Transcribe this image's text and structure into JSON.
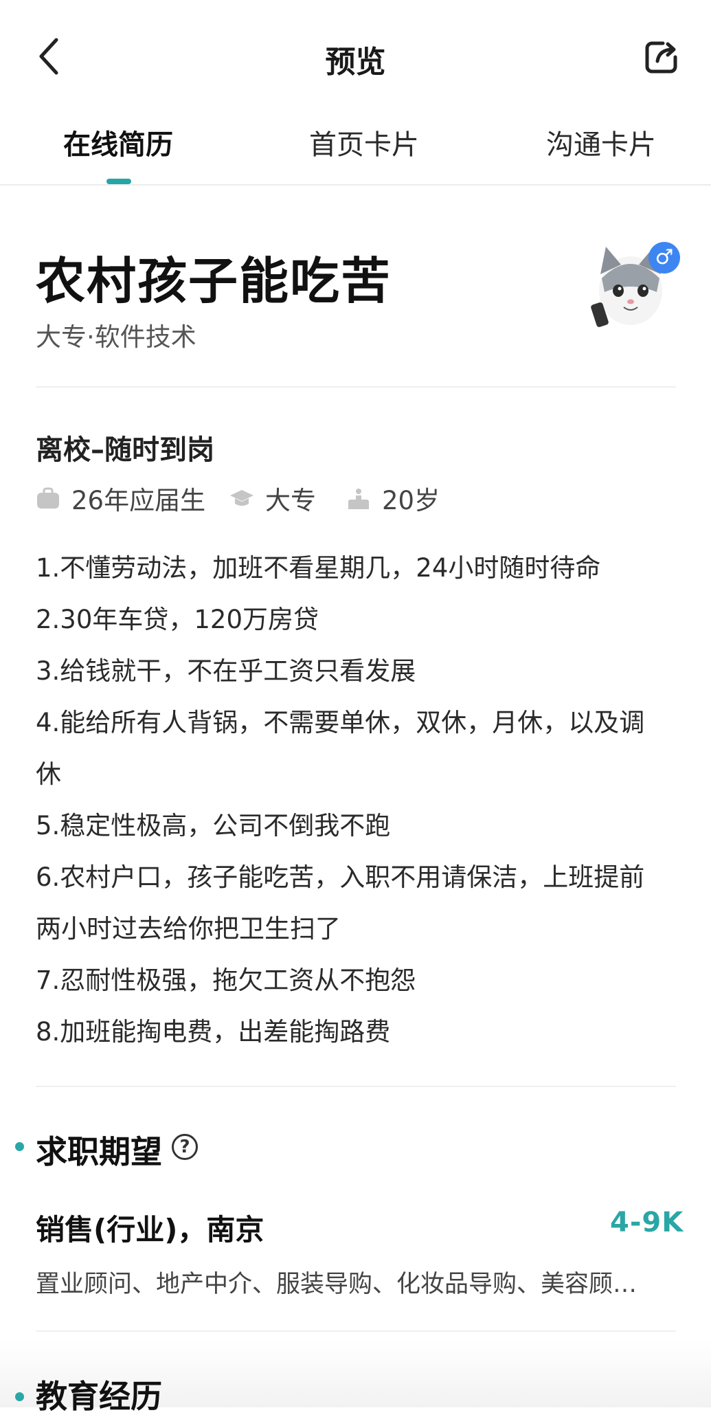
{
  "header": {
    "title": "预览",
    "back_icon": "chevron-left-icon",
    "share_icon": "share-icon"
  },
  "tabs": [
    {
      "label": "在线简历",
      "active": true
    },
    {
      "label": "首页卡片",
      "active": false
    },
    {
      "label": "沟通卡片",
      "active": false
    }
  ],
  "profile": {
    "name": "农村孩子能吃苦",
    "education_major": "大专·软件技术",
    "gender_symbol": "♂",
    "status": "离校–随时到岗",
    "meta": [
      {
        "icon": "briefcase-icon",
        "text": "26年应届生"
      },
      {
        "icon": "graduation-cap-icon",
        "text": "大专"
      },
      {
        "icon": "person-icon",
        "text": "20岁"
      }
    ]
  },
  "advantages": [
    "1.不懂劳动法，加班不看星期几，24小时随时待命",
    "2.30年车贷，120万房贷",
    "3.给钱就干，不在乎工资只看发展",
    "4.能给所有人背锅，不需要单休，双休，月休，以及调",
    "休",
    "5.稳定性极高，公司不倒我不跑",
    "6.农村户口，孩子能吃苦，入职不用请保洁，上班提前",
    "两小时过去给你把卫生扫了",
    "7.忍耐性极强，拖欠工资从不抱怨",
    "8.加班能掏电费，出差能掏路费"
  ],
  "job_expectation": {
    "section_title": "求职期望",
    "help_symbol": "?",
    "title": "销售(行业)，南京",
    "salary": "4-9K",
    "positions": "置业顾问、地产中介、服装导购、化妆品导购、美容顾…"
  },
  "education": {
    "section_title": "教育经历"
  },
  "colors": {
    "accent": "#2aa6a6",
    "gender_badge": "#3d86f2"
  }
}
